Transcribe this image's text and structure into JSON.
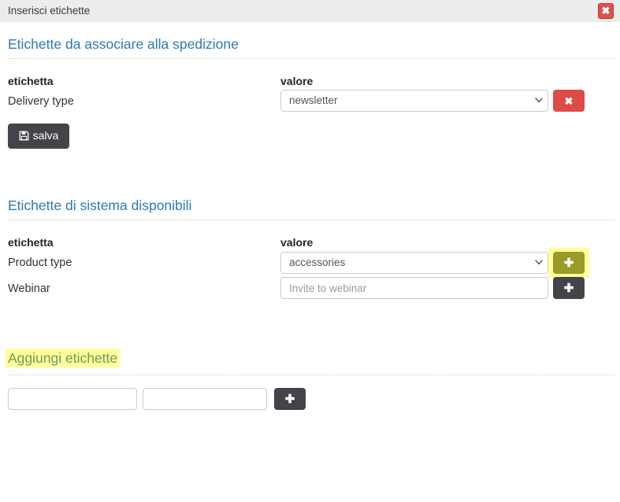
{
  "dialog": {
    "title": "Inserisci etichette",
    "close_icon": "close-icon",
    "close_label": "✖"
  },
  "colors": {
    "heading_blue": "#2a7ab9",
    "highlight_yellow": "#ffff99",
    "danger_red": "#dd4b46",
    "dark_button": "#43434a",
    "olive_button": "#9a9a28",
    "titlebar_gray": "#ececec"
  },
  "sections": [
    {
      "id": "assigned",
      "title": "Etichette da associare alla spedizione",
      "highlighted": false,
      "col_label": "etichetta",
      "col_value": "valore",
      "rows": [
        {
          "label": "Delivery type",
          "control": "select",
          "value": "newsletter",
          "options": [
            "newsletter"
          ],
          "action_label": "✖",
          "action_icon": "remove-icon",
          "action_style": "danger"
        }
      ],
      "save_button": {
        "label": "salva",
        "icon": "save-icon"
      }
    },
    {
      "id": "system",
      "title": "Etichette di sistema disponibili",
      "highlighted": false,
      "col_label": "etichetta",
      "col_value": "valore",
      "rows": [
        {
          "label": "Product type",
          "control": "select",
          "value": "accessories",
          "options": [
            "accessories"
          ],
          "action_label": "✚",
          "action_icon": "plus-icon",
          "action_style": "highlighted"
        },
        {
          "label": "Webinar",
          "control": "text",
          "value": "",
          "placeholder": "Invite to webinar",
          "action_label": "✚",
          "action_icon": "plus-icon",
          "action_style": "dark"
        }
      ]
    },
    {
      "id": "add",
      "title": "Aggiungi etichette",
      "highlighted": true,
      "new_row": {
        "name_value": "",
        "name_placeholder": "",
        "value_value": "",
        "value_placeholder": "",
        "action_label": "✚",
        "action_icon": "plus-icon",
        "action_style": "dark"
      }
    }
  ]
}
